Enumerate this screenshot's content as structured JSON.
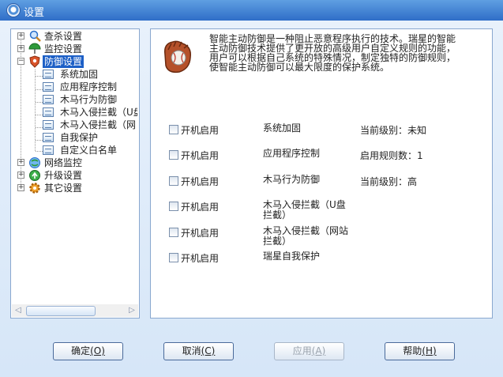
{
  "window": {
    "title": "设置"
  },
  "tree": {
    "items": [
      {
        "label": "查杀设置",
        "icon": "magnifier-icon",
        "expander": "+"
      },
      {
        "label": "监控设置",
        "icon": "umbrella-icon",
        "expander": "+"
      },
      {
        "label": "防御设置",
        "icon": "shield-icon",
        "expander": "−",
        "selected": true
      },
      {
        "label": "系统加固"
      },
      {
        "label": "应用程序控制"
      },
      {
        "label": "木马行为防御"
      },
      {
        "label": "木马入侵拦截（U盘"
      },
      {
        "label": "木马入侵拦截（网"
      },
      {
        "label": "自我保护"
      },
      {
        "label": "自定义白名单"
      },
      {
        "label": "网络监控",
        "icon": "network-icon",
        "expander": "+"
      },
      {
        "label": "升级设置",
        "icon": "upgrade-icon",
        "expander": "+"
      },
      {
        "label": "其它设置",
        "icon": "gear-icon",
        "expander": "+"
      }
    ],
    "scroll_left": "◁",
    "scroll_right": "▷"
  },
  "content": {
    "icon": "baseball-glove-icon",
    "description": "智能主动防御是一种阻止恶意程序执行的技术。瑞星的智能主动防御技术提供了更开放的高级用户自定义规则的功能，用户可以根据自己系统的特殊情况，制定独特的防御规则，使智能主动防御可以最大限度的保护系统。",
    "rows": [
      {
        "checkbox_label": "开机启用",
        "feature": "系统加固",
        "status": "当前级别：未知"
      },
      {
        "checkbox_label": "开机启用",
        "feature": "应用程序控制",
        "status": "启用规则数：1"
      },
      {
        "checkbox_label": "开机启用",
        "feature": "木马行为防御",
        "status": "当前级别：高"
      },
      {
        "checkbox_label": "开机启用",
        "feature": "木马入侵拦截（U盘拦截）",
        "status": ""
      },
      {
        "checkbox_label": "开机启用",
        "feature": "木马入侵拦截（网站拦截）",
        "status": ""
      },
      {
        "checkbox_label": "开机启用",
        "feature": "瑞星自我保护",
        "status": ""
      }
    ]
  },
  "buttons": {
    "ok": {
      "label": "确定",
      "shortcut": "(O)"
    },
    "cancel": {
      "label": "取消",
      "shortcut": "(C)"
    },
    "apply": {
      "label": "应用",
      "shortcut": "(A)"
    },
    "help": {
      "label": "帮助",
      "shortcut": "(H)"
    }
  },
  "colors": {
    "title_bar": "#2f6ec8",
    "selection": "#1c5fc6",
    "panel_border": "#8aa8cf"
  }
}
